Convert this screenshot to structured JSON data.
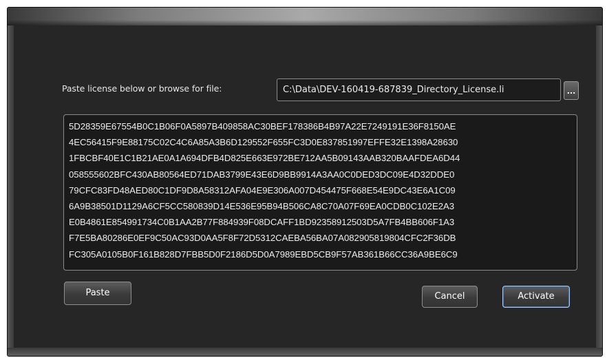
{
  "dialog": {
    "path_label": "Paste license below or browse for file:",
    "path_value": "C:\\Data\\DEV-160419-687839_Directory_License.li",
    "browse_label": "...",
    "license_lines": [
      "5D28359E67554B0C1B06F0A5897B409858AC30BEF178386B4B97A22E7249191E36F8150AE",
      "4EC56415F9E88175C02C4C6A85A3B6D129552F655FC3D0E837851997EFFE32E1398A28630",
      "1FBCBF40E1C1B21AE0A1A694DFB4D825E663E972BE712AA5B09143AAB320BAAFDEA6D44",
      "058555602BFC430AB80564ED71DAB3799E43E6D9BB9914A3AA0C0DED3DC09E4D32DDE0",
      "79CFC83FD48AED80C1DF9D8A58312AFA04E9E306A007D454475F668E54E9DC43E6A1C09",
      "6A9B38501D1129A6CF5CC580839D14E536E95B94B506CA8C70A07F69EA0CDB0C102E2A3",
      "E0B4861E854991734C0B1AA2B77F884939F08DCAFF1BD92358912503D5A7FB4BB606F1A3",
      "F7E5BA80286E0EF9C50AC93D0AA5F8F72D5312CAEBA56BA07A082905819804CFC2F36DB",
      "FC305A0105B0F161B828D7FBB5D0F2186D5D0A7989EBD5CB9F57AB361B66CC36A9BE6C9"
    ],
    "paste_label": "Paste",
    "cancel_label": "Cancel",
    "activate_label": "Activate"
  }
}
